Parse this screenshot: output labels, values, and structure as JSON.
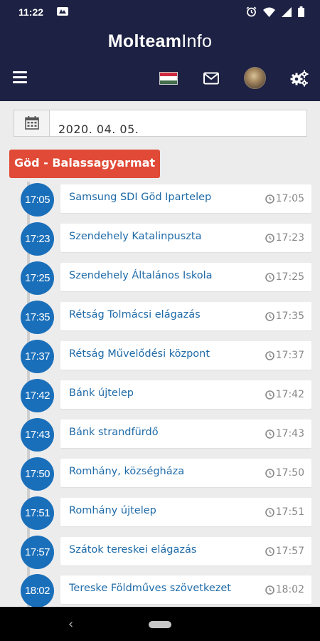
{
  "status_bar": {
    "time": "11:22"
  },
  "app": {
    "title_bold": "Molteam",
    "title_light": "Info"
  },
  "date": {
    "value": "2020. 04. 05."
  },
  "route": {
    "name": "Göd - Balassagyarmat"
  },
  "colors": {
    "header_bg": "#1d2143",
    "bubble": "#1a6fba",
    "route_badge": "#e04a36",
    "stop_text": "#1f6ba8"
  },
  "stops": [
    {
      "time": "17:05",
      "name": "Samsung SDI Göd Ipartelep"
    },
    {
      "time": "17:23",
      "name": "Szendehely Katalinpuszta"
    },
    {
      "time": "17:25",
      "name": "Szendehely Általános Iskola"
    },
    {
      "time": "17:35",
      "name": "Rétság Tolmácsi elágazás"
    },
    {
      "time": "17:37",
      "name": "Rétság Művelődési központ"
    },
    {
      "time": "17:42",
      "name": "Bánk újtelep"
    },
    {
      "time": "17:43",
      "name": "Bánk strandfürdő"
    },
    {
      "time": "17:50",
      "name": "Romhány, községháza"
    },
    {
      "time": "17:51",
      "name": "Romhány újtelep"
    },
    {
      "time": "17:57",
      "name": "Szátok tereskei elágazás"
    },
    {
      "time": "18:02",
      "name": "Tereske Földműves szövetkezet"
    }
  ]
}
